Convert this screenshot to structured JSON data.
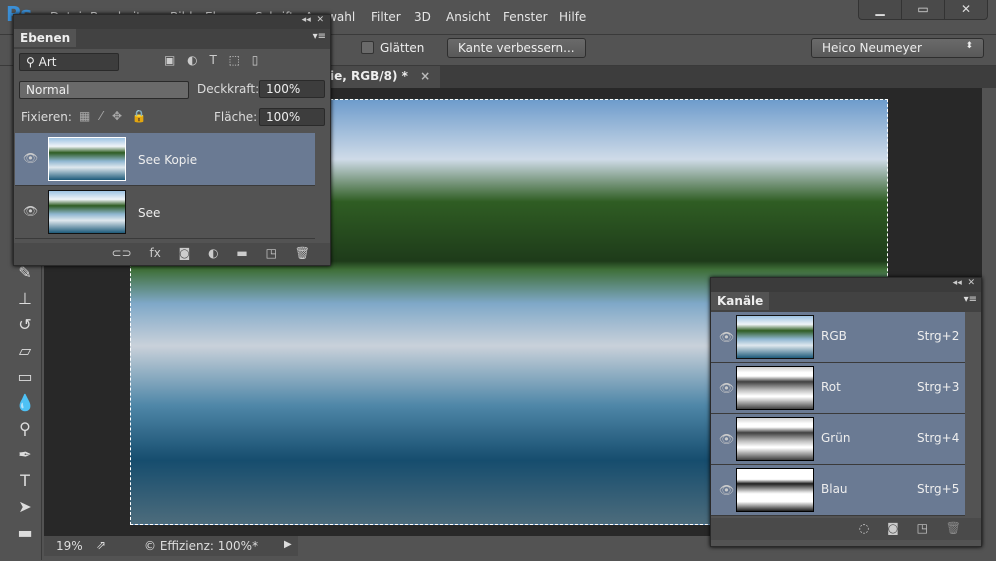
{
  "app": {
    "logo": "Ps",
    "menu": [
      "Datei",
      "Bearbeiten",
      "Bild",
      "Ebene",
      "Schrift",
      "Auswahl",
      "Filter",
      "3D",
      "Ansicht",
      "Fenster",
      "Hilfe"
    ],
    "window_buttons": [
      "minimize",
      "maximize",
      "close"
    ]
  },
  "options": {
    "smooth_label": "Glätten",
    "refine_edge_label": "Kante verbessern...",
    "workspace": "Heico Neumeyer"
  },
  "document_tab": {
    "title": "ie, RGB/8) *",
    "close": "×"
  },
  "status": {
    "zoom": "19%",
    "info": "© Effizienz: 100%*"
  },
  "layers_panel": {
    "title": "Ebenen",
    "filter_kind": "Art",
    "blend_mode": "Normal",
    "opacity_label": "Deckkraft:",
    "opacity": "100%",
    "lock_label": "Fixieren:",
    "fill_label": "Fläche:",
    "fill": "100%",
    "layers": [
      {
        "name": "See Kopie",
        "selected": true,
        "visible": true
      },
      {
        "name": "See",
        "selected": false,
        "visible": true
      }
    ],
    "footer_icons": [
      "link-icon",
      "fx-icon",
      "mask-icon",
      "adjustment-icon",
      "folder-icon",
      "new-layer-icon",
      "trash-icon"
    ]
  },
  "channels_panel": {
    "title": "Kanäle",
    "channels": [
      {
        "name": "RGB",
        "shortcut": "Strg+2"
      },
      {
        "name": "Rot",
        "shortcut": "Strg+3"
      },
      {
        "name": "Grün",
        "shortcut": "Strg+4"
      },
      {
        "name": "Blau",
        "shortcut": "Strg+5"
      }
    ]
  },
  "colors": {
    "selected_row": "#6a7a93",
    "panel": "#535353",
    "accent": "#3b8fd6"
  }
}
